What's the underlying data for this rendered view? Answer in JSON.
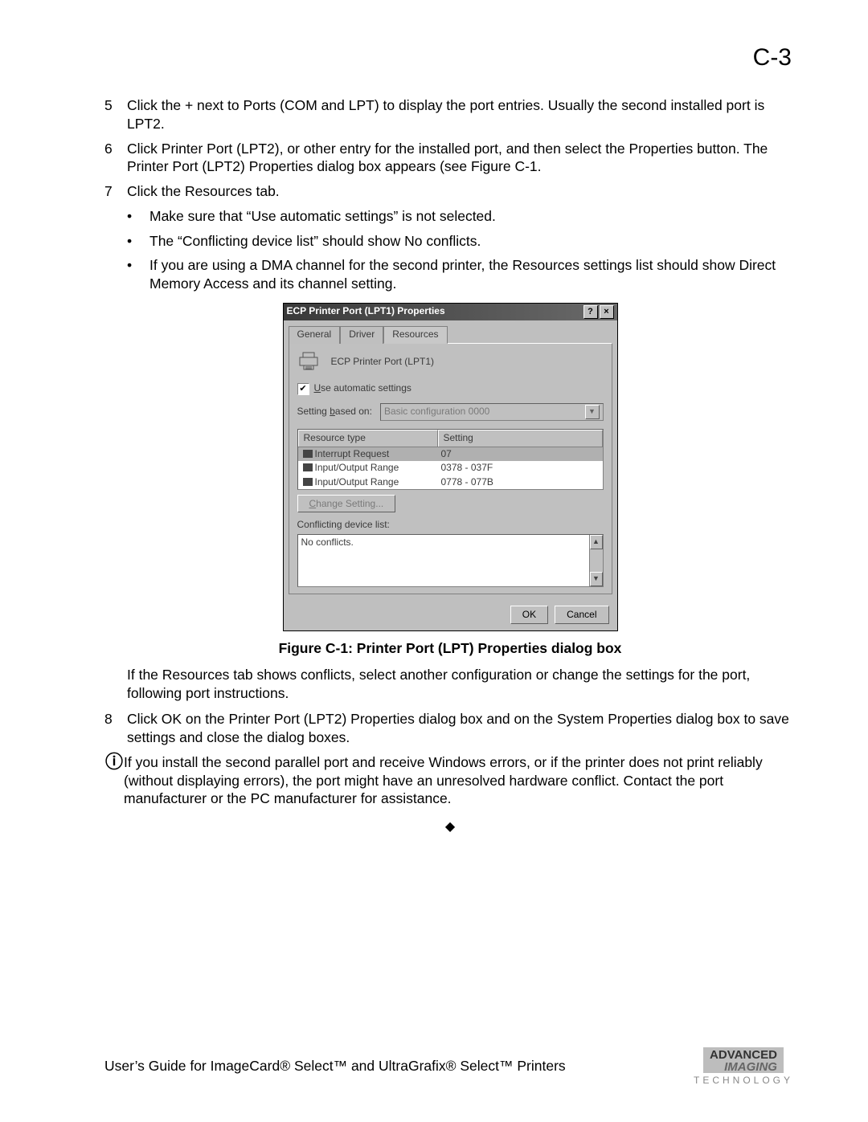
{
  "page_number": "C-3",
  "steps": {
    "s5": {
      "num": "5",
      "text": "Click the + next to Ports (COM and LPT) to display the port entries. Usually the second installed port is LPT2."
    },
    "s6": {
      "num": "6",
      "text": "Click Printer Port (LPT2), or other entry for the installed port, and then select the Properties button. The Printer Port (LPT2) Properties dialog box appears (see Figure C-1."
    },
    "s7": {
      "num": "7",
      "text": "Click the Resources tab."
    },
    "b1": "Make sure that “Use automatic settings” is not selected.",
    "b2": "The “Conflicting device list” should show No conflicts.",
    "b3": "If you are using a DMA channel for the second printer, the Resources settings list should show Direct Memory Access and its channel setting."
  },
  "dialog": {
    "title": "ECP Printer Port (LPT1) Properties",
    "help": "?",
    "close": "×",
    "tabs": {
      "general": "General",
      "driver": "Driver",
      "resources": "Resources"
    },
    "device_name": "ECP Printer Port (LPT1)",
    "auto_label_pre": "U",
    "auto_label": "se automatic settings",
    "based_label_pre": "Setting ",
    "based_label_u": "b",
    "based_label_post": "ased on:",
    "based_value": "Basic configuration 0000",
    "cols": {
      "c1": "Resource type",
      "c2": "Setting"
    },
    "rows": [
      {
        "c1": "Interrupt Request",
        "c2": "07"
      },
      {
        "c1": "Input/Output Range",
        "c2": "0378 - 037F"
      },
      {
        "c1": "Input/Output Range",
        "c2": "0778 - 077B"
      }
    ],
    "change_pre": "C",
    "change_post": "hange Setting...",
    "conflict_label": "Conflicting device list:",
    "conflict_text": "No conflicts.",
    "ok": "OK",
    "cancel": "Cancel"
  },
  "figure_caption": "Figure C-1: Printer Port (LPT) Properties dialog box",
  "after_fig": "If the Resources tab shows conflicts, select another configuration or change the settings for the port, following port instructions.",
  "step8": {
    "num": "8",
    "text": "Click OK on the Printer Port (LPT2) Properties dialog box and on the System Properties dialog box to save settings and close the dialog boxes."
  },
  "info_text": "If you install the second parallel port and receive Windows errors, or if the printer does not print reliably (without displaying errors), the port might have an unresolved hardware conflict. Contact the port manufacturer or the PC manufacturer for assistance.",
  "footer_text": "User’s Guide for ImageCard® Select™ and UltraGrafix® Select™ Printers",
  "logo": {
    "l1": "ADVANCED",
    "l2": "IMAGING",
    "bottom": "TECHNOLOGY"
  }
}
